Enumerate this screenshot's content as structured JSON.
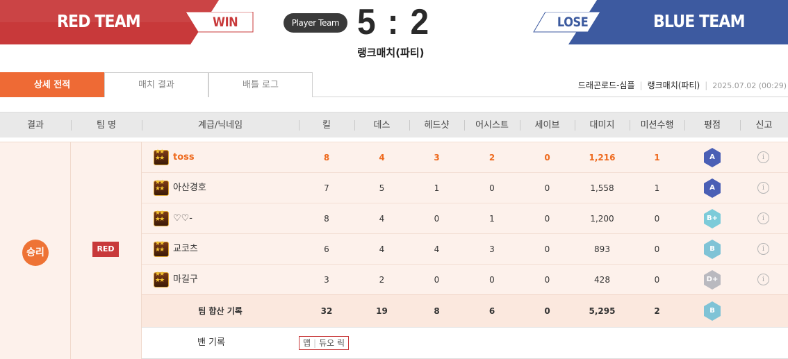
{
  "header": {
    "red_team": "RED TEAM",
    "red_result": "WIN",
    "blue_team": "BLUE TEAM",
    "blue_result": "LOSE",
    "player_team_label": "Player Team",
    "score": "5 : 2",
    "match_type": "랭크매치(파티)",
    "colors": {
      "red": "#c8393a",
      "blue": "#3d5aa0",
      "accent": "#ee6a35"
    }
  },
  "tabs": [
    {
      "label": "상세 전적",
      "active": true
    },
    {
      "label": "매치 결과",
      "active": false
    },
    {
      "label": "배틀 로그",
      "active": false
    }
  ],
  "meta": {
    "map": "드래곤로드-심플",
    "mode": "랭크매치(파티)",
    "datetime": "2025.07.02 (00:29)"
  },
  "columns": [
    "결과",
    "팀 명",
    "계급/닉네임",
    "킬",
    "데스",
    "헤드샷",
    "어시스트",
    "세이브",
    "대미지",
    "미션수행",
    "평점",
    "신고"
  ],
  "result_label": "승리",
  "team_label": "RED",
  "players": [
    {
      "nick": "toss",
      "kill": "8",
      "death": "4",
      "headshot": "3",
      "assist": "2",
      "save": "0",
      "damage": "1,216",
      "mission": "1",
      "grade": "A",
      "grade_color": "#4a5fb5",
      "report": "i"
    },
    {
      "nick": "아산경호",
      "kill": "7",
      "death": "5",
      "headshot": "1",
      "assist": "0",
      "save": "0",
      "damage": "1,558",
      "mission": "1",
      "grade": "A",
      "grade_color": "#4a5fb5",
      "report": "i"
    },
    {
      "nick": "♡♡-",
      "kill": "8",
      "death": "4",
      "headshot": "0",
      "assist": "1",
      "save": "0",
      "damage": "1,200",
      "mission": "0",
      "grade": "B+",
      "grade_color": "#7ccbd9",
      "report": "i"
    },
    {
      "nick": "교코츠",
      "kill": "6",
      "death": "4",
      "headshot": "4",
      "assist": "3",
      "save": "0",
      "damage": "893",
      "mission": "0",
      "grade": "B",
      "grade_color": "#7fc3d6",
      "report": "i"
    },
    {
      "nick": "마길구",
      "kill": "3",
      "death": "2",
      "headshot": "0",
      "assist": "0",
      "save": "0",
      "damage": "428",
      "mission": "0",
      "grade": "D+",
      "grade_color": "#b9b9bf",
      "report": "i"
    }
  ],
  "total": {
    "label": "팀 합산 기록",
    "kill": "32",
    "death": "19",
    "headshot": "8",
    "assist": "6",
    "save": "0",
    "damage": "5,295",
    "mission": "2",
    "grade": "B",
    "grade_color": "#7fc3d6"
  },
  "ban": {
    "label": "밴 기록",
    "items": [
      "맵",
      "듀오 릭"
    ]
  }
}
